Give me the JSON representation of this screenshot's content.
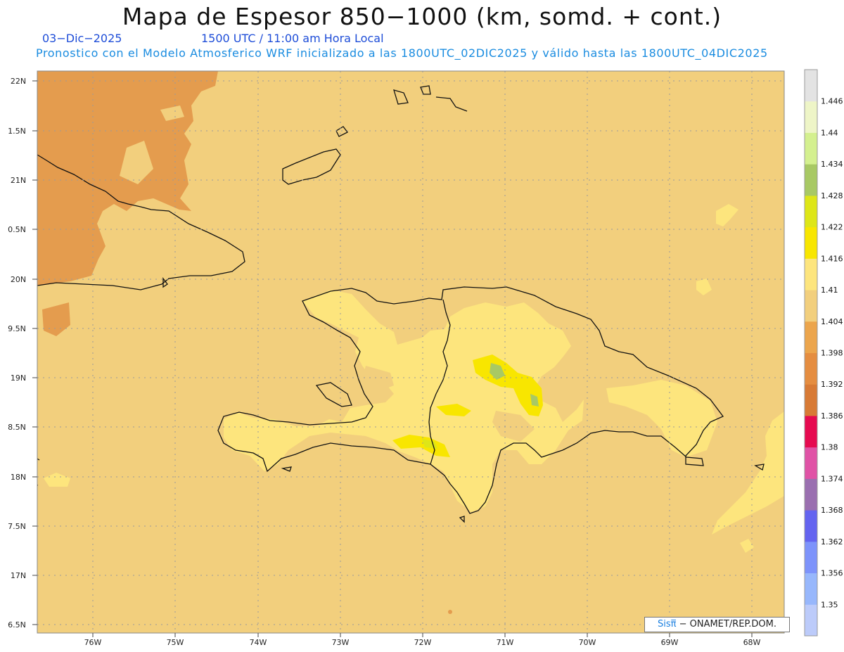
{
  "title": "Mapa de Espesor 850−1000 (km, somd. + cont.)",
  "date": "03−Dic−2025",
  "time": "1500 UTC / 11:00 am Hora Local",
  "forecast_line": "Pronostico con el Modelo Atmosferico WRF inicializado a las 1800UTC_02DIC2025 y válido hasta las  1800UTC_04DIC2025",
  "credit": {
    "brand": "Sisπ̅",
    "org": " − ONAMET/REP.DOM."
  },
  "axes": {
    "lat_ticks": [
      "22N",
      "1.5N",
      "21N",
      "0.5N",
      "20N",
      "9.5N",
      "19N",
      "8.5N",
      "18N",
      "7.5N",
      "17N",
      "6.5N"
    ],
    "lon_ticks": [
      "76W",
      "75W",
      "74W",
      "73W",
      "72W",
      "71W",
      "70W",
      "69W",
      "68W"
    ]
  },
  "colorbar": {
    "labels": [
      "1.35",
      "1.356",
      "1.362",
      "1.368",
      "1.374",
      "1.38",
      "1.386",
      "1.392",
      "1.398",
      "1.404",
      "1.41",
      "1.416",
      "1.422",
      "1.428",
      "1.434",
      "1.44",
      "1.446"
    ],
    "colors": [
      "#bccbfa",
      "#97b7fc",
      "#7d93fb",
      "#6464f0",
      "#9a6fb0",
      "#e052a6",
      "#e60a50",
      "#d87a35",
      "#e58d40",
      "#eca54c",
      "#f2cf7d",
      "#fde57d",
      "#f8e600",
      "#dee617",
      "#a8c964",
      "#d4f08f",
      "#eef5c7",
      "#e3e3e3"
    ]
  },
  "colors": {
    "background_field": "#f2cf7d",
    "warm_field": "#e49c4e",
    "higher_field": "#fde57d",
    "peak_field": "#f8e600",
    "max_field": "#a8c964"
  }
}
